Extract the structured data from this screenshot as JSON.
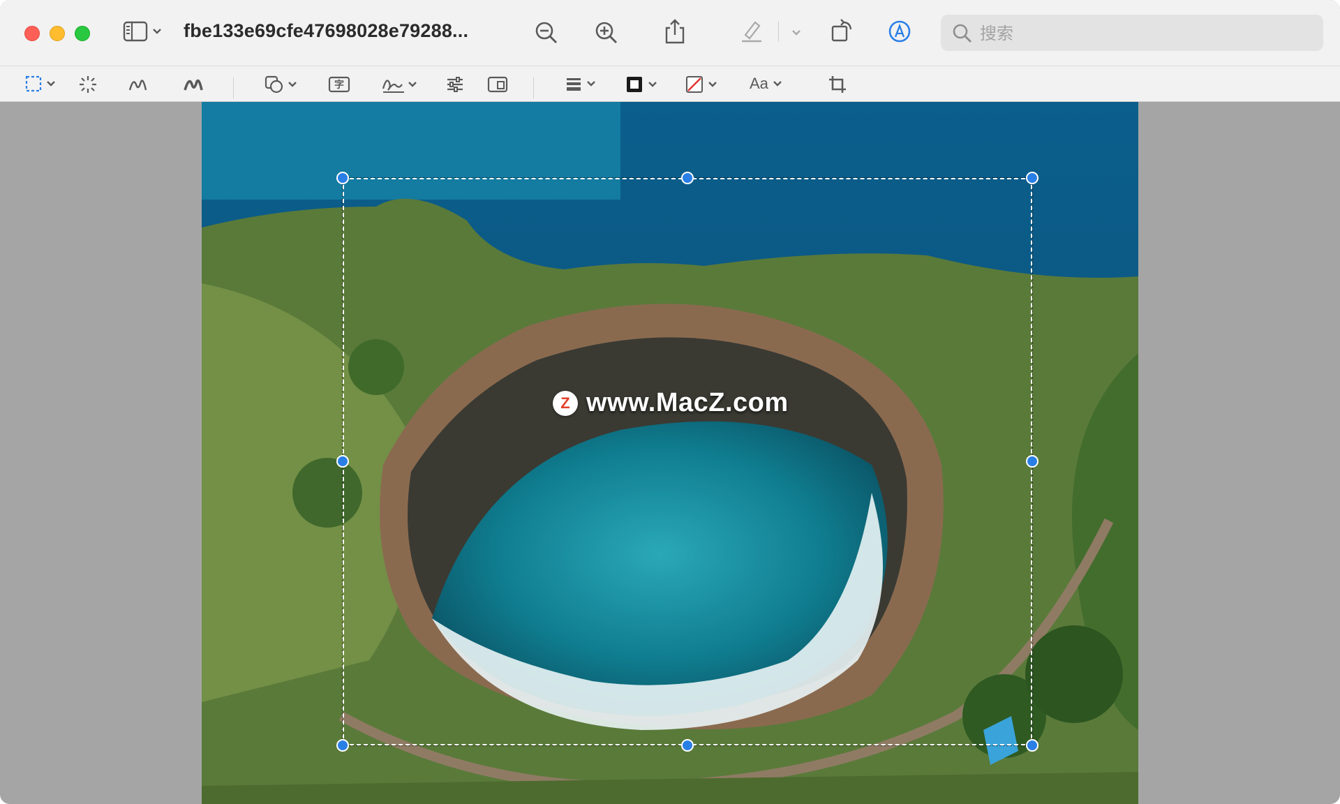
{
  "window": {
    "title": "fbe133e69cfe47698028e79288...",
    "accent": "#2a7fe6"
  },
  "search": {
    "placeholder": "搜索"
  },
  "toolbar": {
    "icons": [
      "sidebar-icon",
      "chevron-down-icon",
      "zoom-out-icon",
      "zoom-in-icon",
      "share-icon",
      "highlight-pen-icon",
      "chevron-down-icon",
      "rotate-icon",
      "markup-icon"
    ]
  },
  "markup": {
    "text_style_label": "Aa",
    "text_box_glyph": "字"
  },
  "canvas": {
    "watermark_logo": "Z",
    "watermark_text": "www.MacZ.com"
  }
}
